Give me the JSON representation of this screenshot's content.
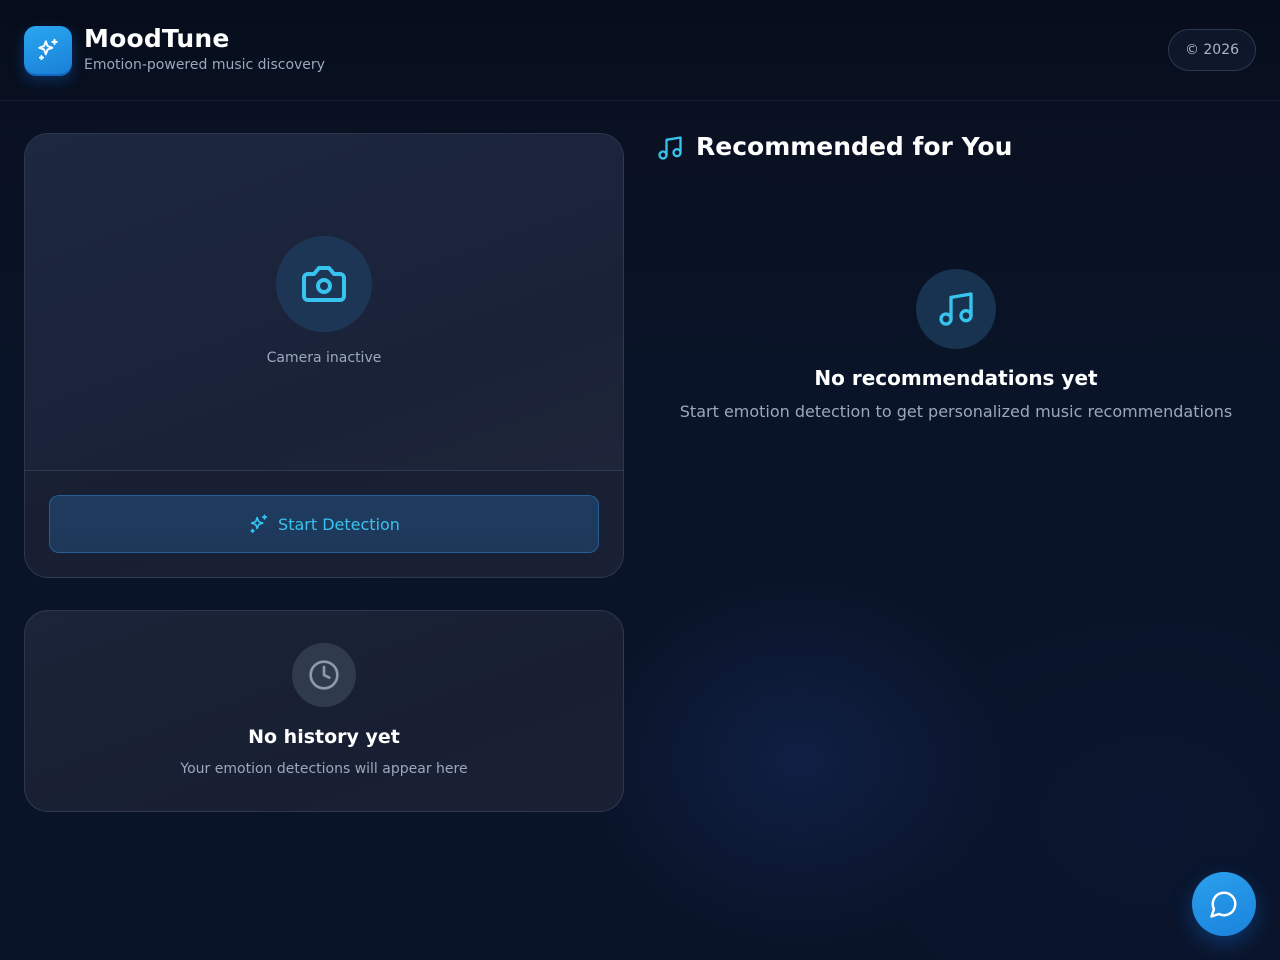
{
  "header": {
    "app_name": "MoodTune",
    "tagline": "Emotion-powered music discovery",
    "copyright": "© 2026",
    "logo_icon": "sparkles-icon"
  },
  "camera": {
    "status": "Camera inactive",
    "icon": "camera-icon",
    "start_button_label": "Start Detection",
    "start_button_icon": "sparkles-icon"
  },
  "history": {
    "icon": "clock-icon",
    "empty_title": "No history yet",
    "empty_subtitle": "Your emotion detections will appear here"
  },
  "recommendations": {
    "heading": "Recommended for You",
    "heading_icon": "music-note-icon",
    "empty_title": "No recommendations yet",
    "empty_subtitle": "Start emotion detection to get personalized music recommendations"
  },
  "chat": {
    "icon": "chat-bubble-icon"
  },
  "colors": {
    "accent": "#38c3ee",
    "brand_blue": "#1f8fe3",
    "background": "#0a1428",
    "card": "#1b2438"
  }
}
